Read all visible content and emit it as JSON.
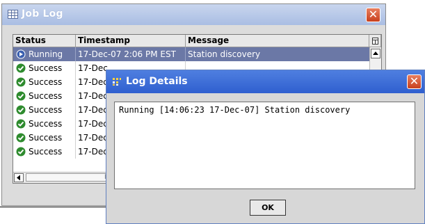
{
  "job_log": {
    "title": "Job Log",
    "close_label": "✕",
    "columns": [
      "Status",
      "Timestamp",
      "Message"
    ],
    "column_menu_icon": "column-chooser-icon",
    "rows": [
      {
        "status": "Running",
        "timestamp": "17-Dec-07 2:06 PM EST",
        "message": "Station discovery",
        "selected": true
      },
      {
        "status": "Success",
        "timestamp": "17-Dec",
        "message": "",
        "selected": false
      },
      {
        "status": "Success",
        "timestamp": "17-Dec",
        "message": "",
        "selected": false
      },
      {
        "status": "Success",
        "timestamp": "17-Dec",
        "message": "",
        "selected": false
      },
      {
        "status": "Success",
        "timestamp": "17-Dec",
        "message": "",
        "selected": false
      },
      {
        "status": "Success",
        "timestamp": "17-Dec",
        "message": "",
        "selected": false
      },
      {
        "status": "Success",
        "timestamp": "17-Dec",
        "message": "",
        "selected": false
      },
      {
        "status": "Success",
        "timestamp": "17-Dec",
        "message": "",
        "selected": false
      }
    ],
    "hscroll_grip": "III"
  },
  "log_details": {
    "title": "Log Details",
    "close_label": "✕",
    "text": "Running [14:06:23 17-Dec-07] Station discovery",
    "ok_label": "OK"
  },
  "colors": {
    "selected_row": "#6b78a6",
    "success_green": "#2e8b2e",
    "running_blue": "#3a5fb0",
    "close_red": "#d0502a",
    "dialog_title_blue": "#2f5fcf"
  }
}
